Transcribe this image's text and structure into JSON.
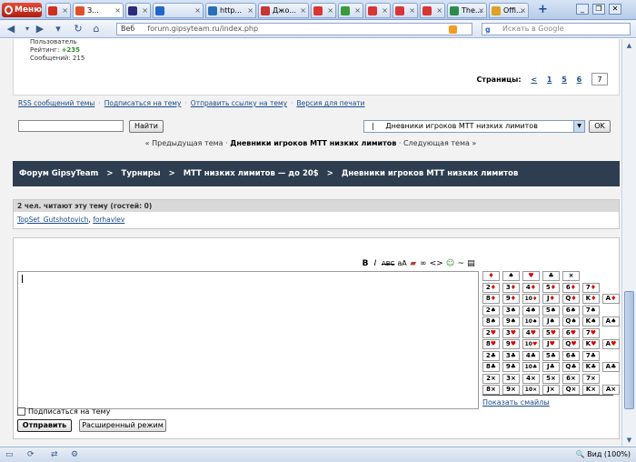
{
  "browser": {
    "menu_label": "Меню",
    "tabs": [
      {
        "title": "",
        "color": "#d12d1d"
      },
      {
        "title": "З...",
        "color": "#e0502a"
      },
      {
        "title": "",
        "color": "#2c2c7a"
      },
      {
        "title": "",
        "color": "#2266cc"
      },
      {
        "title": "http...",
        "color": "#2a6fb5"
      },
      {
        "title": "Джо...",
        "color": "#cc3333"
      },
      {
        "title": "",
        "color": "#d33"
      },
      {
        "title": "",
        "color": "#3a9b3a"
      },
      {
        "title": "",
        "color": "#d33"
      },
      {
        "title": "",
        "color": "#d33"
      },
      {
        "title": "",
        "color": "#d33"
      },
      {
        "title": "The...",
        "color": "#2c8b4a"
      },
      {
        "title": "Offi...",
        "color": "#e0a020"
      }
    ],
    "web_label": "Веб",
    "url": "forum.gipsyteam.ru/index.php",
    "search_placeholder": "Искать в Google",
    "status_zoom": "Вид (100%)"
  },
  "post_author": {
    "line1": "Пользователь",
    "rating_label": "Рейтинг:",
    "rating_value": "+235",
    "messages": "Сообщений: 215"
  },
  "pagination": {
    "label": "Страницы:",
    "prev": "<",
    "pages": [
      "1",
      "5",
      "6"
    ],
    "current": "7"
  },
  "topic_links": {
    "rss": "RSS сообщений темы",
    "subscribe": "Подписаться на тему",
    "send_link": "Отправить ссылку на тему",
    "print": "Версия для печати",
    "separator": "·"
  },
  "forum_search": {
    "find_button": "Найти",
    "forum_select_value": "|     Дневники игроков МТТ низких лимитов",
    "ok_button": "OK"
  },
  "topic_nav": {
    "prev": "« Предыдущая тема",
    "current": "Дневники игроков МТТ низких лимитов",
    "next": "Следующая тема »",
    "separator": "·"
  },
  "breadcrumb": {
    "items": [
      "Форум GipsyTeam",
      "Турниры",
      "МТТ низких лимитов — до 20$",
      "Дневники игроков МТТ низких лимитов"
    ],
    "separator": ">"
  },
  "readers": {
    "header": "2 чел. читают эту тему (гостей: 0)",
    "users": [
      "TopSet_Gutshotovich",
      "forhavlev"
    ],
    "separator": ", "
  },
  "reply": {
    "toolbar": [
      "B",
      "I",
      "ABC",
      "aA",
      "▰",
      "∞",
      "<>",
      "☺",
      "~",
      "▤"
    ],
    "show_smileys": "Показать смайлы",
    "subscribe_label": "Подписаться на тему",
    "submit_button": "Отправить",
    "advanced_button": "Расширенный режим",
    "suit_header": [
      {
        "s": "♦",
        "c": "r"
      },
      {
        "s": "♠",
        "c": "k"
      },
      {
        "s": "♥",
        "c": "r"
      },
      {
        "s": "♣",
        "c": "k"
      },
      {
        "s": "×",
        "c": "k"
      }
    ],
    "card_ranks": [
      "2",
      "3",
      "4",
      "5",
      "6",
      "7",
      "8",
      "9",
      "10",
      "J",
      "Q",
      "K",
      "A"
    ],
    "card_rows": [
      {
        "suit": "♦",
        "c": "r"
      },
      {
        "suit": "♠",
        "c": "k"
      },
      {
        "suit": "♥",
        "c": "r"
      },
      {
        "suit": "♣",
        "c": "k"
      },
      {
        "suit": "×",
        "c": "k"
      }
    ]
  },
  "colors": {
    "breadcrumb_bg": "#2e3e50",
    "link": "#1a4b8c",
    "red_suit": "#e00000",
    "rating_plus": "#2d8b2d"
  }
}
